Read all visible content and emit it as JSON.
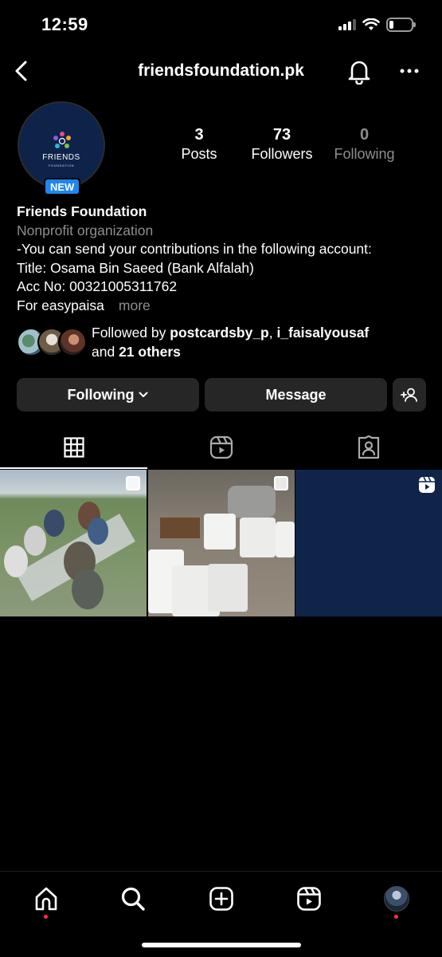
{
  "status_bar": {
    "time": "12:59"
  },
  "header": {
    "username": "friendsfoundation.pk"
  },
  "profile": {
    "avatar_text": "FRIENDS",
    "avatar_subtext": "FOUNDATION",
    "new_badge": "NEW",
    "stats": {
      "posts": {
        "value": "3",
        "label": "Posts"
      },
      "followers": {
        "value": "73",
        "label": "Followers"
      },
      "following": {
        "value": "0",
        "label": "Following"
      }
    },
    "name": "Friends Foundation",
    "category": "Nonprofit organization",
    "bio_lines": [
      "-You can send your contributions in the following account:",
      "Title: Osama Bin Saeed (Bank Alfalah)",
      "Acc No: 00321005311762",
      "For easypaisa"
    ],
    "more_label": "more",
    "followed_by": {
      "prefix": "Followed by",
      "user1": "postcardsby_p",
      "separator": ",",
      "user2": "i_faisalyousaf",
      "and": "and",
      "others": "21 others"
    }
  },
  "actions": {
    "following_label": "Following",
    "message_label": "Message"
  },
  "tabs": [
    {
      "name": "posts-grid",
      "icon": "grid-icon",
      "active": true
    },
    {
      "name": "reels",
      "icon": "reels-icon",
      "active": false
    },
    {
      "name": "tagged",
      "icon": "tagged-icon",
      "active": false
    }
  ],
  "grid_posts": [
    {
      "type": "carousel",
      "icon": "multiple-posts-icon"
    },
    {
      "type": "carousel",
      "icon": "multiple-posts-icon"
    },
    {
      "type": "reel",
      "icon": "reel-icon"
    }
  ],
  "bottom_nav": [
    "home-icon",
    "search-icon",
    "new-post-icon",
    "reels-icon",
    "profile-avatar"
  ],
  "colors": {
    "accent": "#1f86f0",
    "button_bg": "#262626",
    "muted": "#8e8e8e",
    "notification_dot": "#ff3040"
  }
}
